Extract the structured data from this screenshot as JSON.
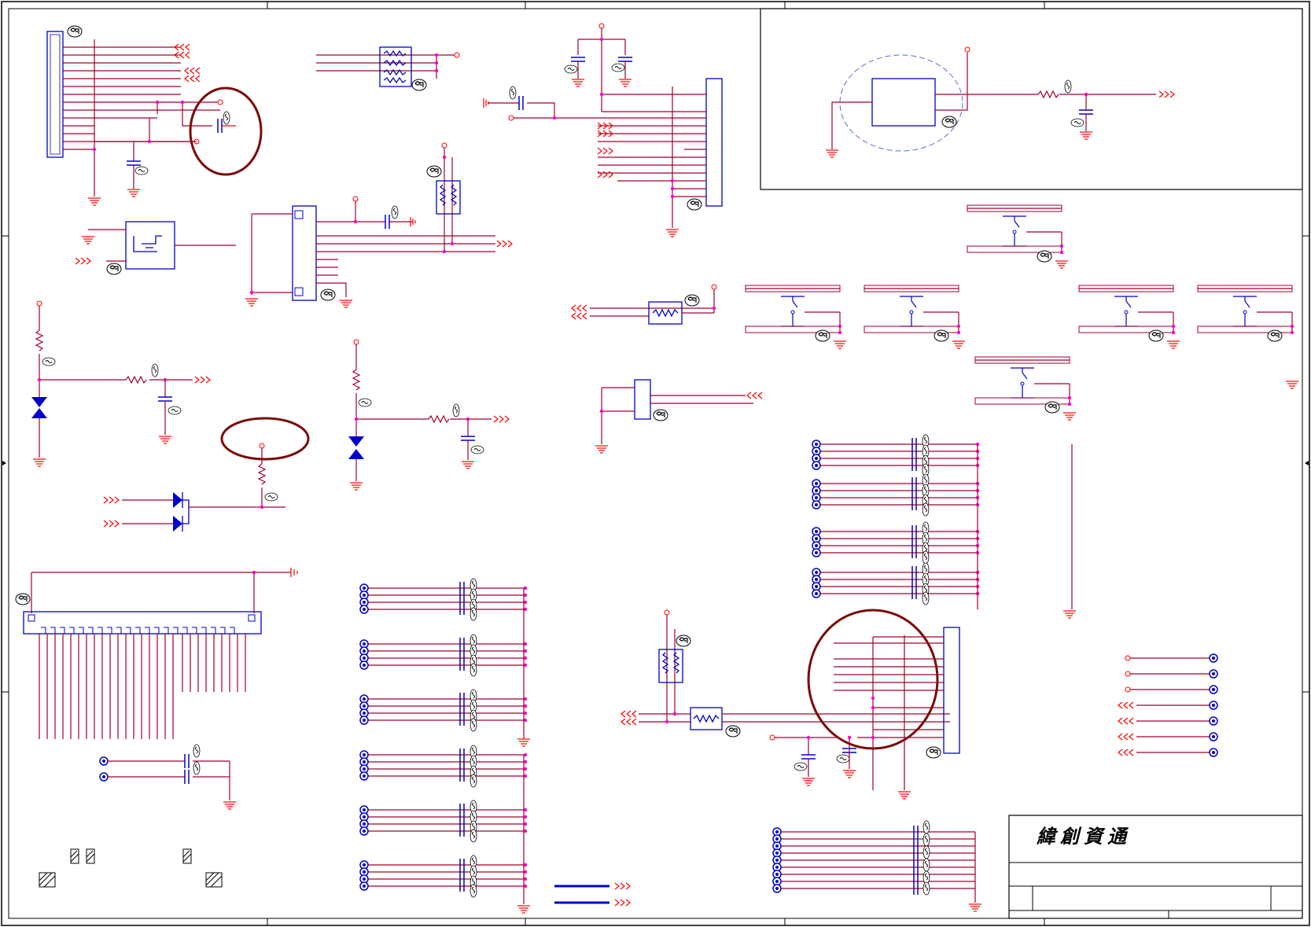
{
  "title_block": {
    "company": "緯創資通"
  },
  "ref_badge": "GP",
  "colors": {
    "wire": "#a0002a",
    "net": "#ff0000",
    "part": "#0000cc",
    "junction": "#ff00cc",
    "highlight": "#7a0a0a",
    "frame": "#000000"
  }
}
